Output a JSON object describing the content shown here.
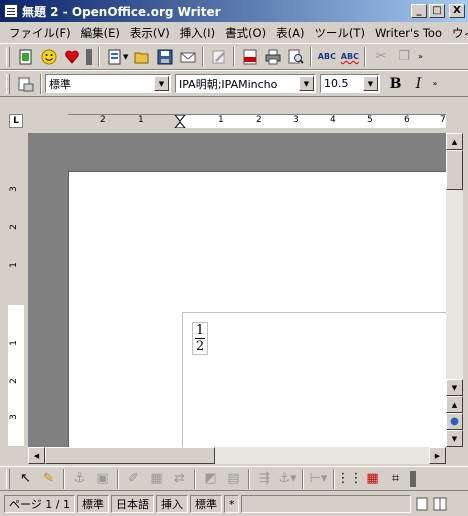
{
  "window": {
    "title": "無題 2 - OpenOffice.org Writer",
    "minimize_label": "_",
    "maximize_label": "□",
    "close_label": "X"
  },
  "menu": [
    {
      "label": "ファイル(F)"
    },
    {
      "label": "編集(E)"
    },
    {
      "label": "表示(V)"
    },
    {
      "label": "挿入(I)"
    },
    {
      "label": "書式(O)"
    },
    {
      "label": "表(A)"
    },
    {
      "label": "ツール(T)"
    },
    {
      "label": "Writer's Too"
    },
    {
      "label": "ウィ"
    }
  ],
  "formatting": {
    "paragraph_style": "標準",
    "font_name": "IPA明朝;IPAMincho",
    "font_size": "10.5",
    "bold_label": "B",
    "italic_label": "I"
  },
  "ruler": {
    "tab_selector": "L",
    "h_numbers": [
      "2",
      "1",
      "1",
      "2",
      "3",
      "4",
      "5",
      "6",
      "7"
    ],
    "v_numbers": [
      "3",
      "2",
      "1",
      "1",
      "2",
      "3"
    ]
  },
  "document": {
    "fraction": {
      "numerator": "1",
      "denominator": "2"
    }
  },
  "statusbar": {
    "page": "ページ 1 / 1",
    "page_style": "標準",
    "language": "日本語",
    "insert_mode": "挿入",
    "selection_mode": "標準",
    "modified": "*"
  },
  "icons": [
    "new-icon",
    "smiley-icon",
    "heart-icon",
    "templates-icon",
    "open-icon",
    "save-icon",
    "email-icon",
    "edit-icon",
    "pdf-icon",
    "print-icon",
    "preview-icon",
    "spellcheck-icon",
    "autospell-icon",
    "cut-icon",
    "copy-icon",
    "styles-icon"
  ]
}
